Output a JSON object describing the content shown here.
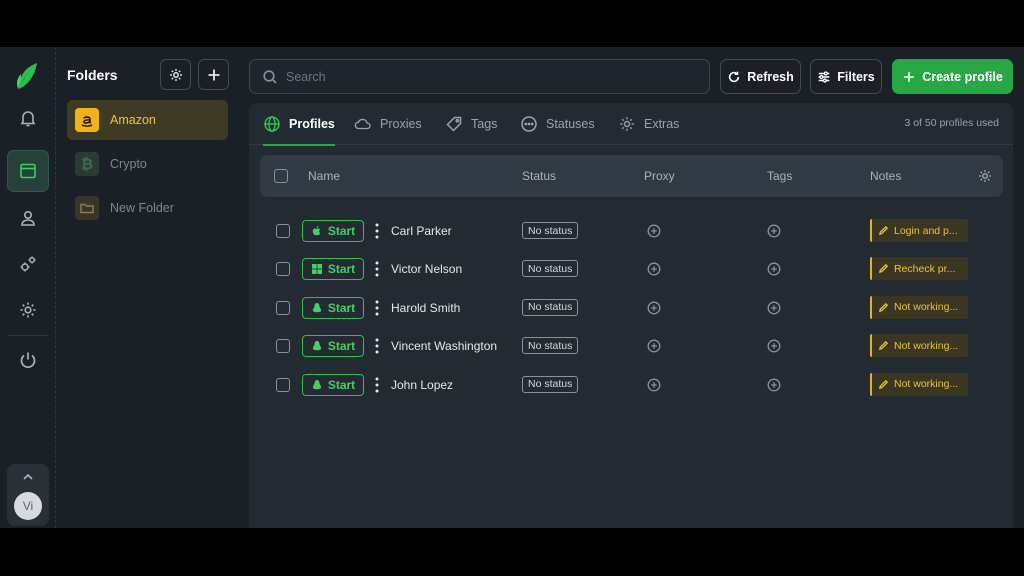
{
  "rail": {
    "items": [
      "bell-icon",
      "profiles-icon",
      "user-icon",
      "gears-icon",
      "settings-icon",
      "power-icon"
    ],
    "avatar_initials": "Vi"
  },
  "folders": {
    "title": "Folders",
    "items": [
      {
        "label": "Amazon",
        "icon": "amazon-icon",
        "active": true
      },
      {
        "label": "Crypto",
        "icon": "bitcoin-icon",
        "active": false
      },
      {
        "label": "New Folder",
        "icon": "folder-icon",
        "active": false
      }
    ]
  },
  "toolbar": {
    "search_placeholder": "Search",
    "refresh_label": "Refresh",
    "filters_label": "Filters",
    "create_label": "Create profile"
  },
  "tabs": [
    {
      "label": "Profiles",
      "icon": "globe-icon",
      "active": true
    },
    {
      "label": "Proxies",
      "icon": "cloud-icon",
      "active": false
    },
    {
      "label": "Tags",
      "icon": "tag-icon",
      "active": false
    },
    {
      "label": "Statuses",
      "icon": "dots-circle-icon",
      "active": false
    },
    {
      "label": "Extras",
      "icon": "gear-icon",
      "active": false
    }
  ],
  "usage_text": "3 of 50 profiles used",
  "table": {
    "columns": [
      "Name",
      "Status",
      "Proxy",
      "Tags",
      "Notes"
    ],
    "rows": [
      {
        "os": "apple-icon",
        "start": "Start",
        "name": "Carl Parker",
        "status": "No status",
        "note": "Login and p..."
      },
      {
        "os": "windows-icon",
        "start": "Start",
        "name": "Victor Nelson",
        "status": "No status",
        "note": "Recheck pr..."
      },
      {
        "os": "linux-icon",
        "start": "Start",
        "name": "Harold Smith",
        "status": "No status",
        "note": "Not working..."
      },
      {
        "os": "linux-icon",
        "start": "Start",
        "name": "Vincent Washington",
        "status": "No status",
        "note": "Not working..."
      },
      {
        "os": "linux-icon",
        "start": "Start",
        "name": "John Lopez",
        "status": "No status",
        "note": "Not working..."
      }
    ]
  },
  "colors": {
    "accent_green": "#28a745",
    "note_yellow": "#e0b422",
    "background": "#1b2026"
  }
}
